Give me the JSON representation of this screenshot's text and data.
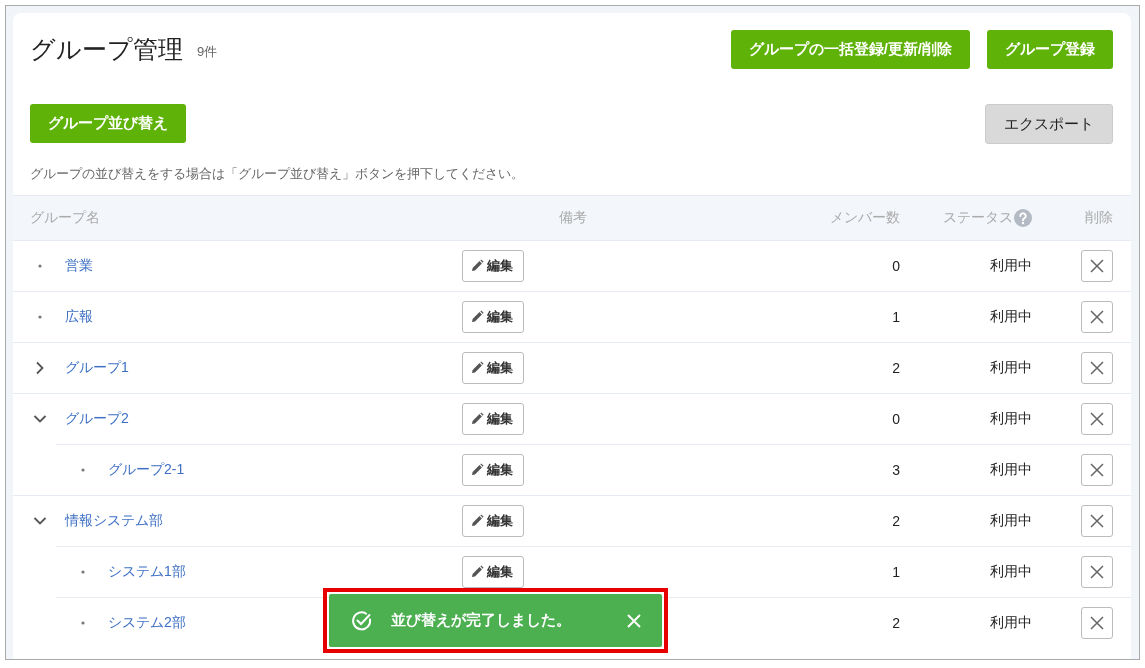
{
  "page": {
    "title": "グループ管理",
    "count": "9件"
  },
  "header_buttons": [
    {
      "label": "グループの一括登録/更新/削除",
      "kind": "primary"
    },
    {
      "label": "グループ登録",
      "kind": "primary"
    }
  ],
  "toolbar_buttons": [
    {
      "label": "グループ並び替え",
      "kind": "primary"
    },
    {
      "label": "エクスポート",
      "kind": "secondary"
    }
  ],
  "hint": "グループの並び替えをする場合は「グループ並び替え」ボタンを押下してください。",
  "table": {
    "columns": [
      "グループ名",
      "備考",
      "メンバー数",
      "ステータス",
      "削除"
    ],
    "rows": [
      {
        "name": "営業",
        "edit": "編集",
        "members": "0",
        "status": "利用中"
      },
      {
        "name": "広報",
        "edit": "編集",
        "members": "1",
        "status": "利用中"
      },
      {
        "name": "グループ1",
        "edit": "編集",
        "members": "2",
        "status": "利用中",
        "expanded": false
      },
      {
        "name": "グループ2",
        "edit": "編集",
        "members": "0",
        "status": "利用中",
        "expanded": true,
        "children": [
          {
            "name": "グループ2-1",
            "edit": "編集",
            "members": "3",
            "status": "利用中"
          }
        ]
      },
      {
        "name": "情報システム部",
        "edit": "編集",
        "members": "2",
        "status": "利用中",
        "expanded": true,
        "children": [
          {
            "name": "システム1部",
            "edit": "編集",
            "members": "1",
            "status": "利用中"
          },
          {
            "name": "システム2部",
            "members": "2",
            "status": "利用中"
          }
        ]
      }
    ]
  },
  "toast": {
    "message": "並び替えが完了しました。",
    "highlighted": true
  }
}
